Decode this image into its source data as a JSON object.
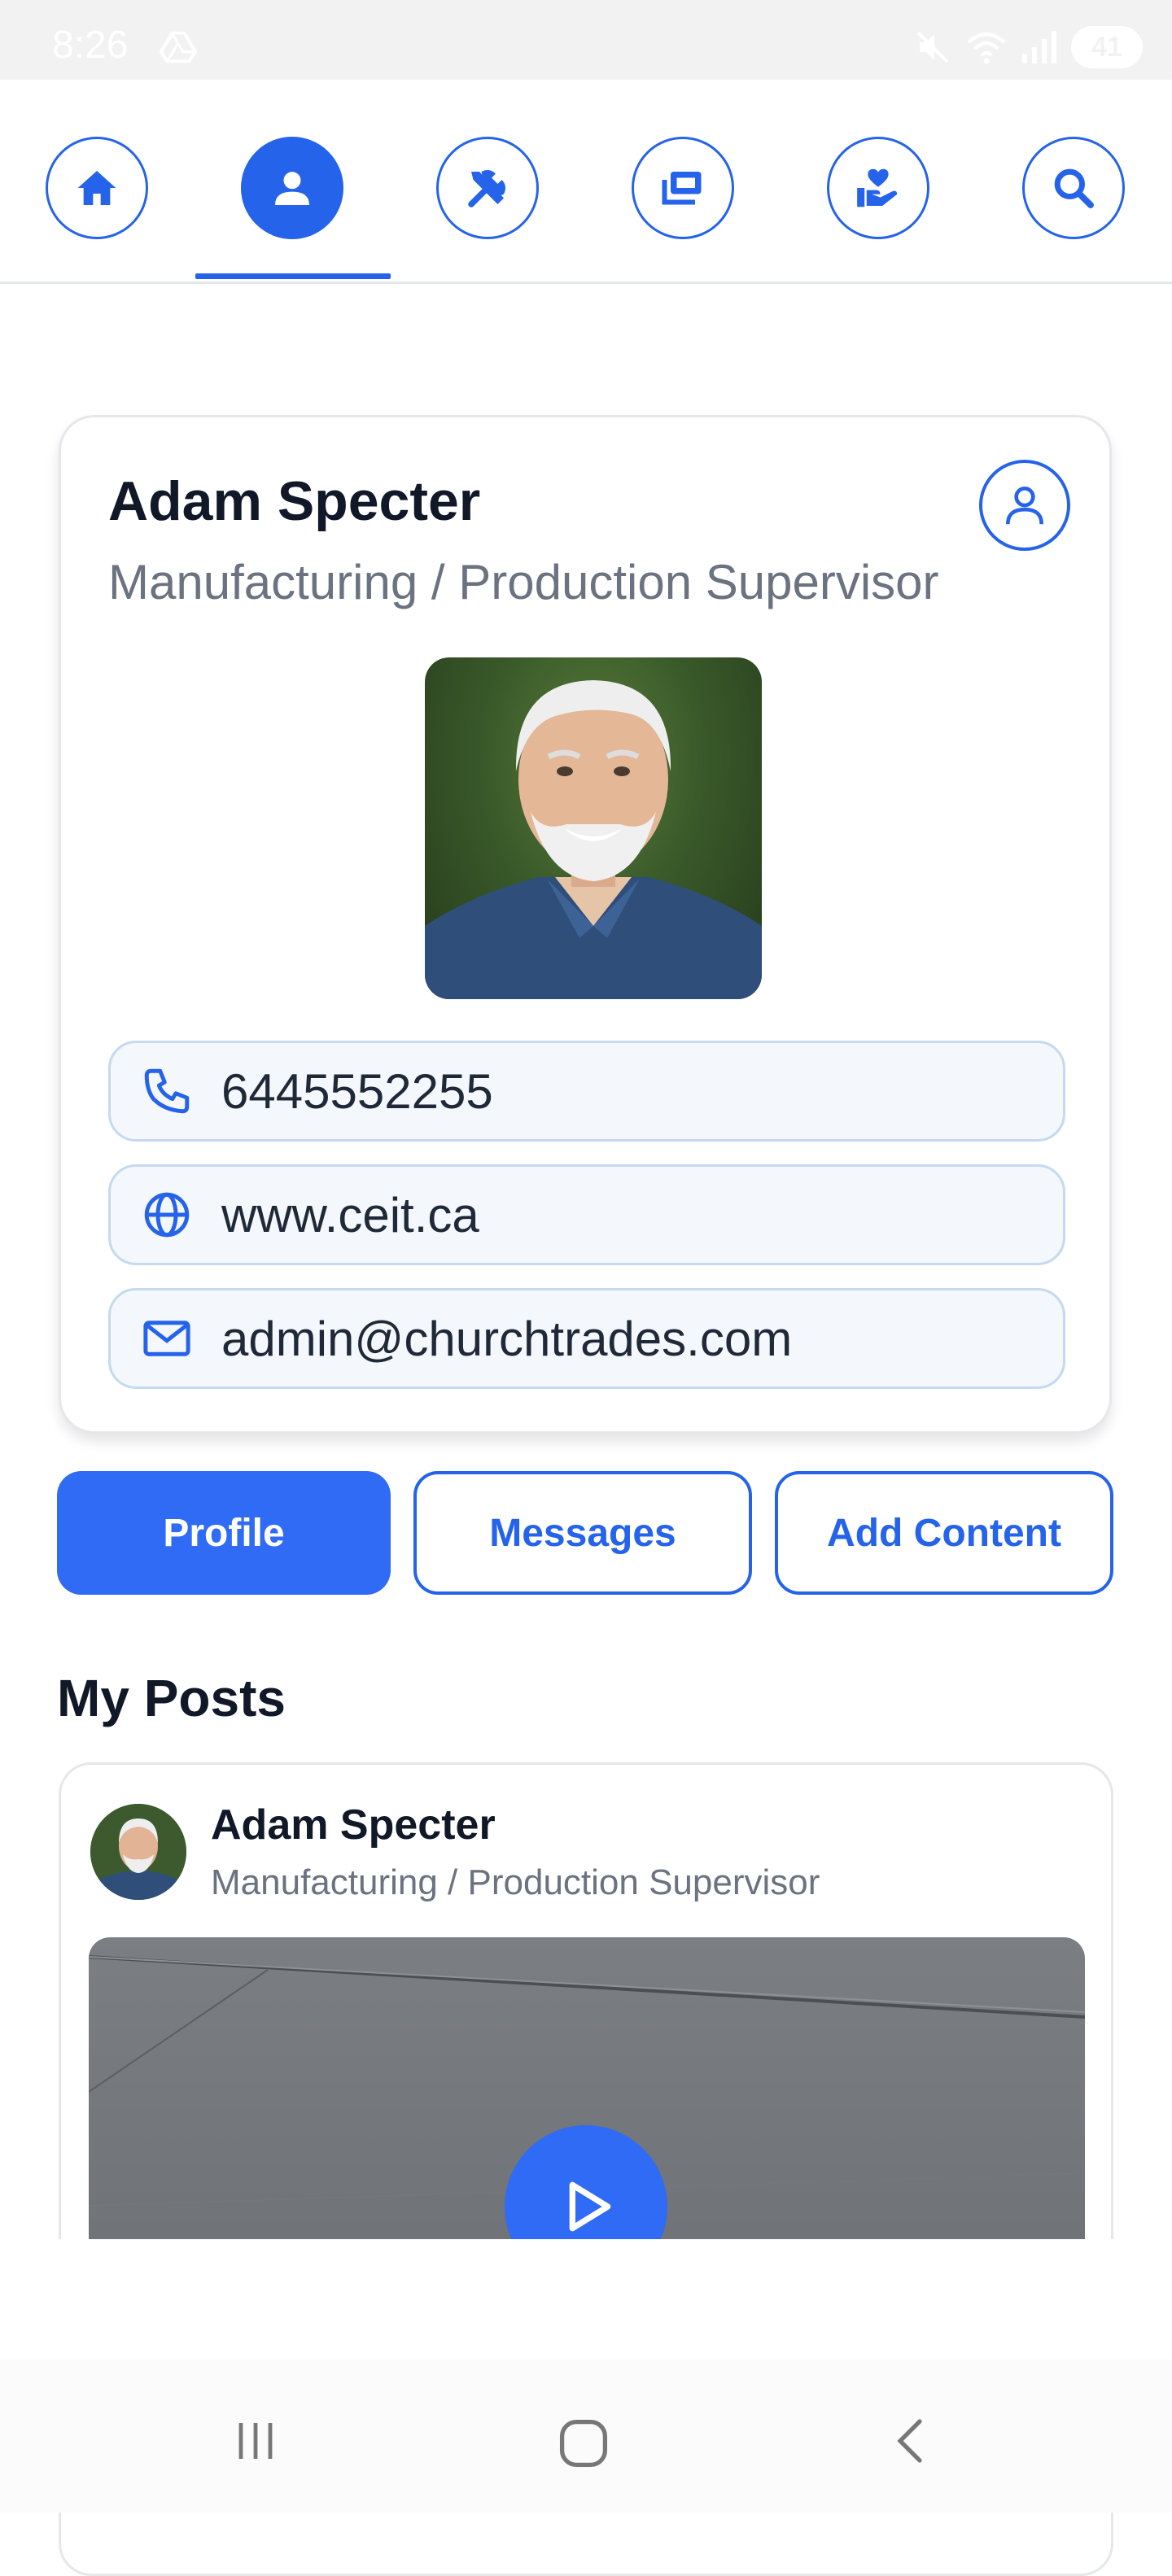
{
  "status_bar": {
    "time": "8:26",
    "battery": "41"
  },
  "nav": {
    "items": [
      {
        "name": "home",
        "icon": "home-icon"
      },
      {
        "name": "profile",
        "icon": "person-icon",
        "active": true
      },
      {
        "name": "tools",
        "icon": "tools-icon"
      },
      {
        "name": "money",
        "icon": "cash-icon"
      },
      {
        "name": "giving",
        "icon": "hand-heart-icon"
      },
      {
        "name": "search",
        "icon": "search-icon"
      }
    ],
    "accent": "#2563eb"
  },
  "profile": {
    "name": "Adam Specter",
    "role": "Manufacturing / Production Supervisor",
    "phone": "6445552255",
    "website": "www.ceit.ca",
    "email": "admin@churchtrades.com"
  },
  "actions": {
    "profile": "Profile",
    "messages": "Messages",
    "add_content": "Add Content"
  },
  "posts": {
    "section_title": "My Posts",
    "items": [
      {
        "author": "Adam Specter",
        "role": "Manufacturing / Production Supervisor"
      }
    ]
  }
}
